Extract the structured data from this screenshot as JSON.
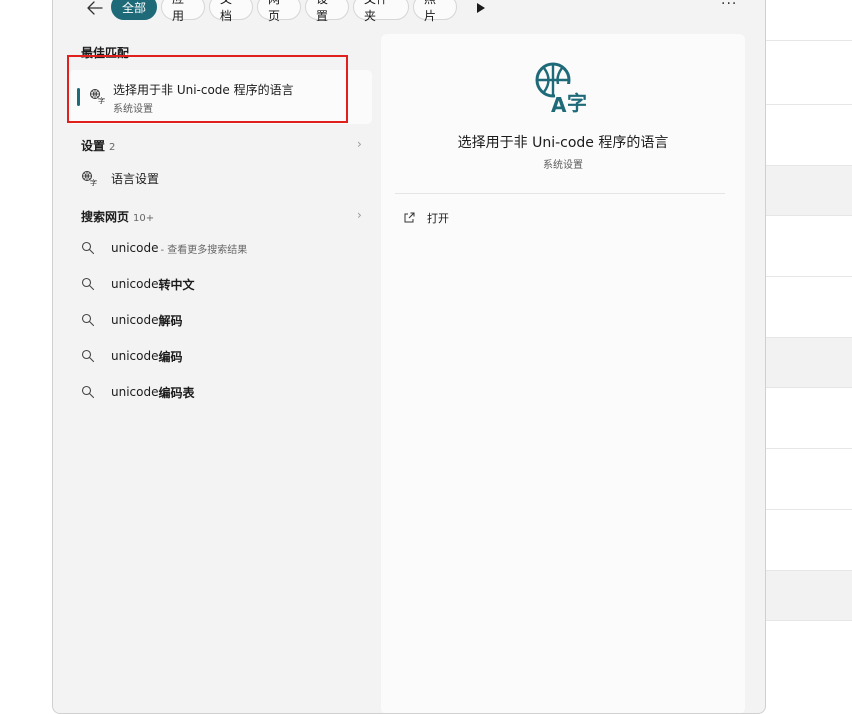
{
  "filters": {
    "tabs": [
      {
        "label": "全部",
        "active": true
      },
      {
        "label": "应用"
      },
      {
        "label": "文档"
      },
      {
        "label": "网页"
      },
      {
        "label": "设置"
      },
      {
        "label": "文件夹"
      },
      {
        "label": "照片"
      }
    ],
    "more": "···"
  },
  "best_match": {
    "heading": "最佳匹配",
    "title": "选择用于非 Uni-code 程序的语言",
    "subtitle": "系统设置"
  },
  "settings_section": {
    "heading": "设置",
    "count": "2",
    "items": [
      {
        "label": "语言设置",
        "icon": "language-icon"
      }
    ]
  },
  "web_section": {
    "heading": "搜索网页",
    "count": "10+",
    "items": [
      {
        "prefix": "unicode",
        "suffix": "",
        "hint": " - 查看更多搜索结果"
      },
      {
        "prefix": "unicode",
        "suffix": "转中文"
      },
      {
        "prefix": "unicode",
        "suffix": "解码"
      },
      {
        "prefix": "unicode",
        "suffix": "编码"
      },
      {
        "prefix": "unicode",
        "suffix": "编码表"
      }
    ]
  },
  "preview": {
    "title": "选择用于非 Uni-code 程序的语言",
    "subtitle": "系统设置",
    "actions": [
      {
        "label": "打开",
        "icon": "open-external-icon"
      }
    ]
  },
  "colors": {
    "accent": "#1e6a78",
    "highlight_box": "#e0201c"
  }
}
